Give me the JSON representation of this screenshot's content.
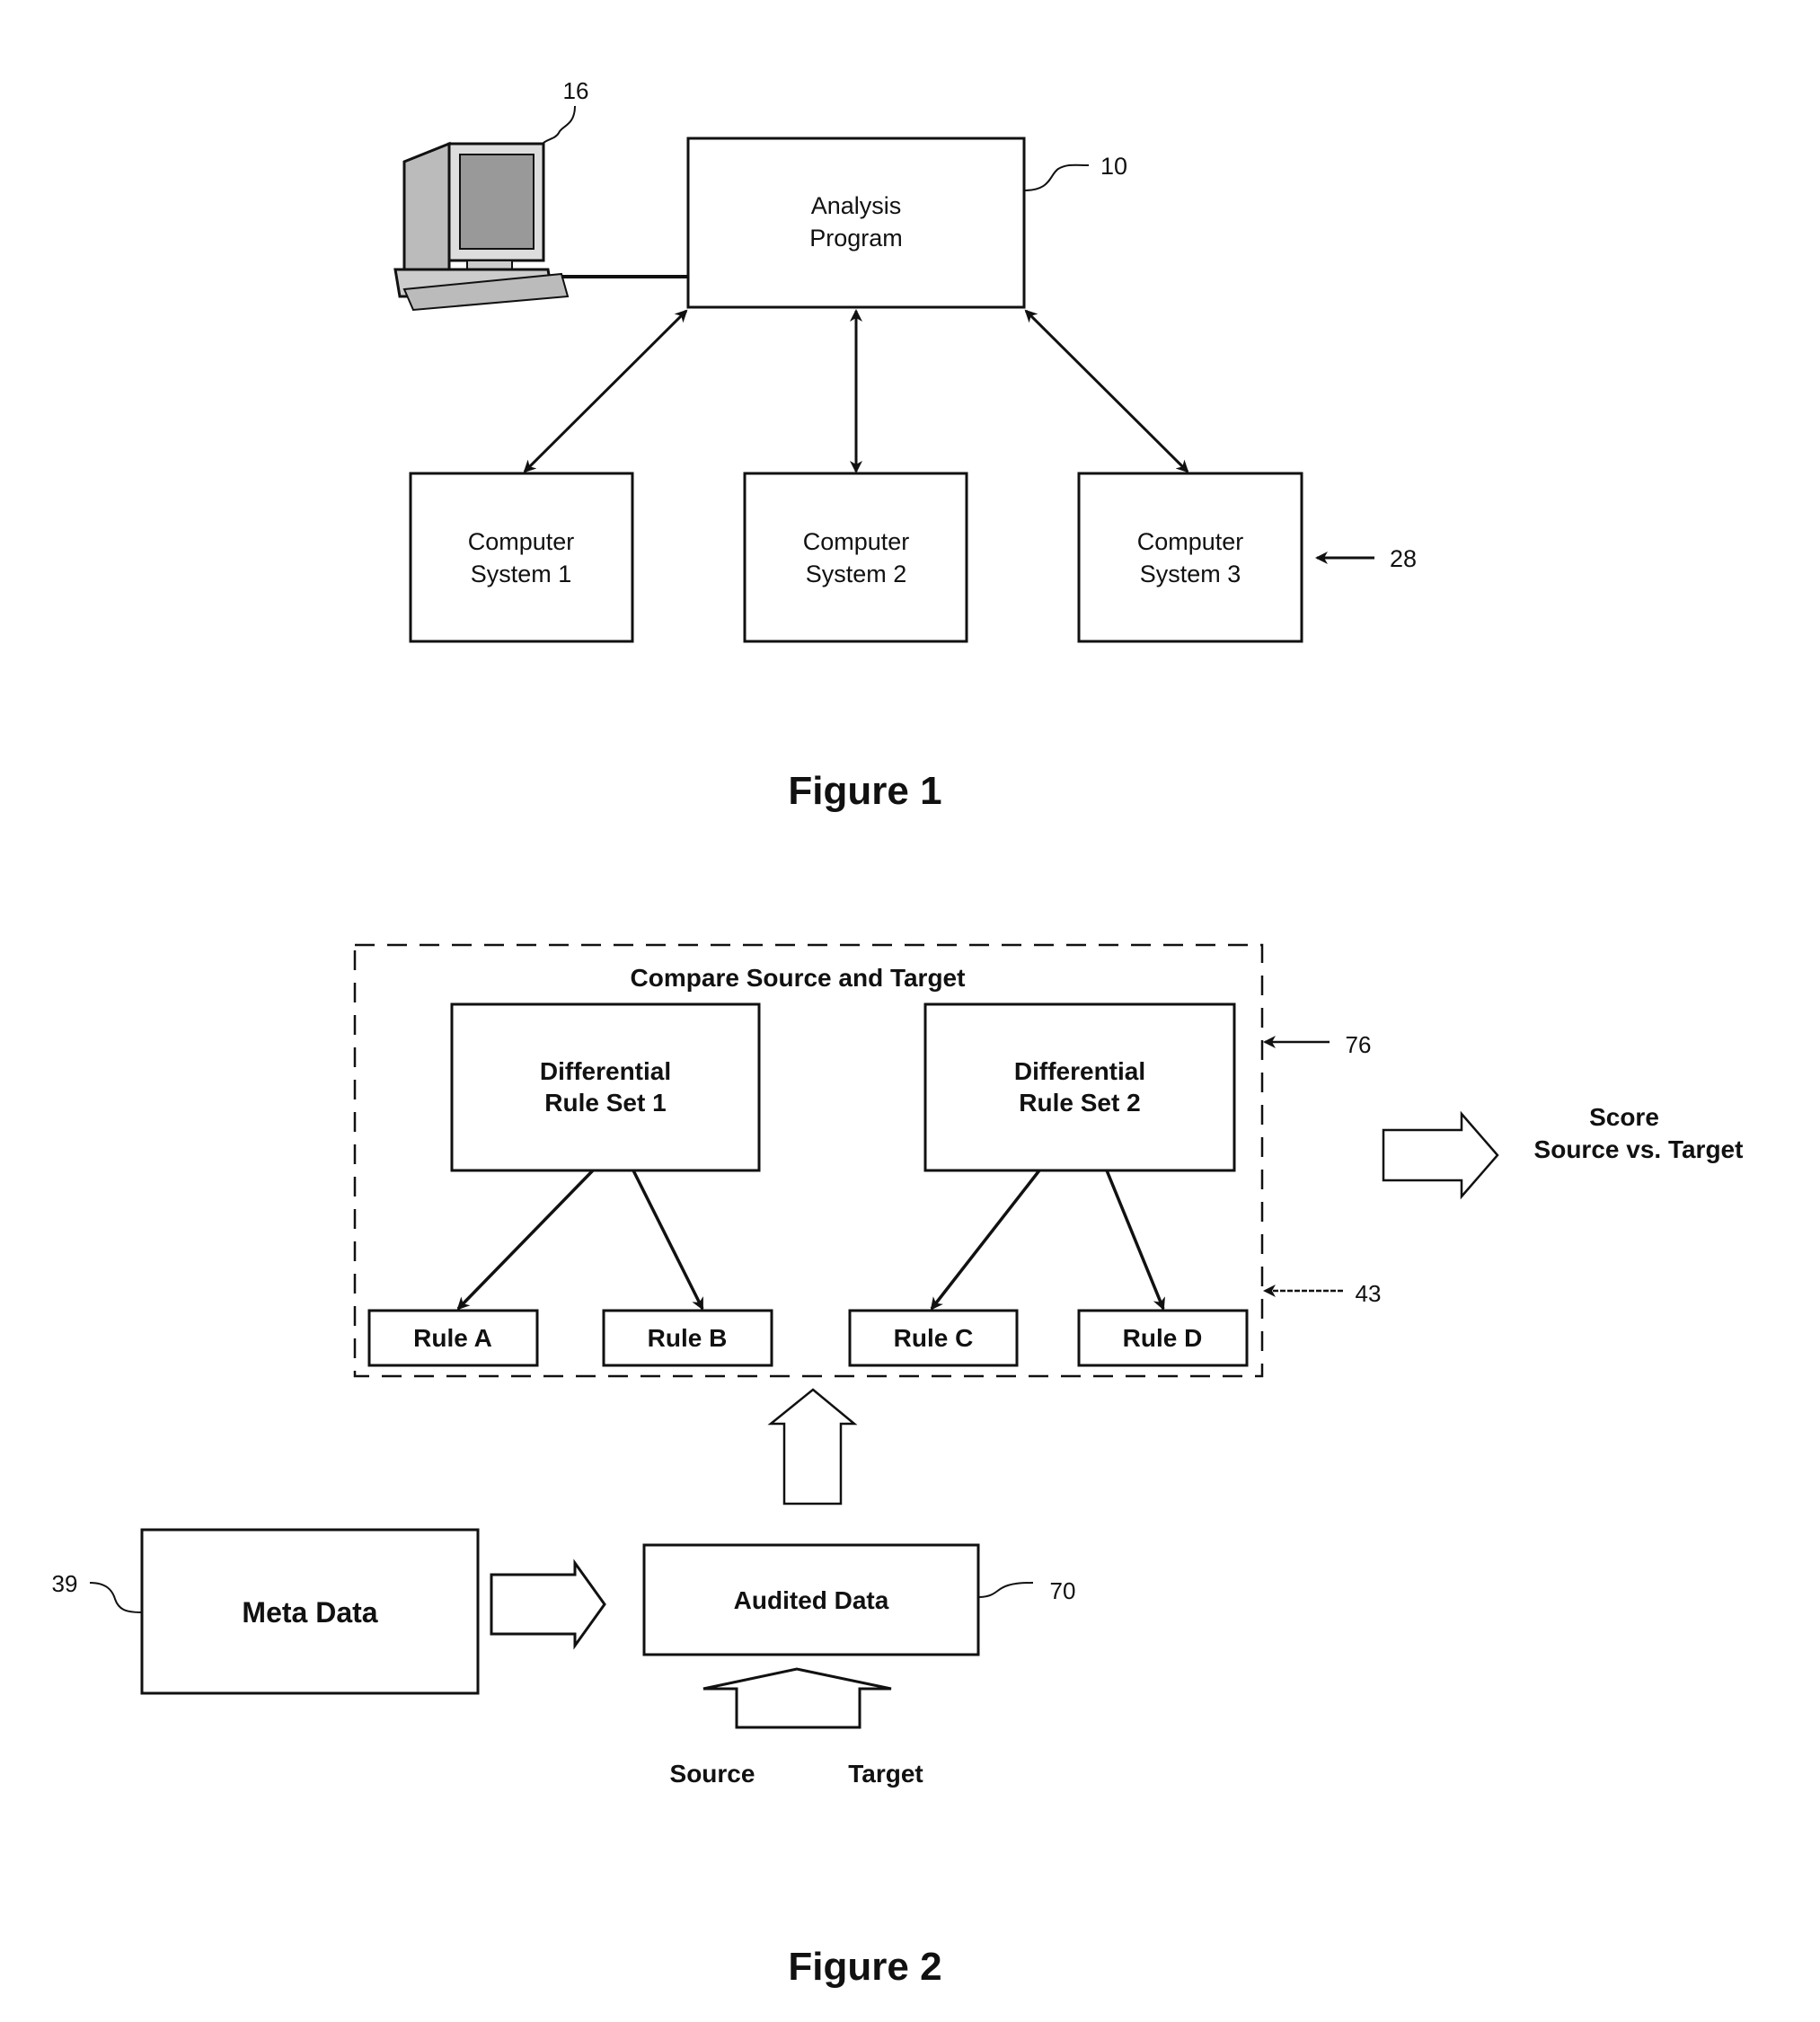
{
  "figure1": {
    "caption": "Figure 1",
    "analysis_program": {
      "line1": "Analysis",
      "line2": "Program",
      "ref": "10"
    },
    "computer_ref": "16",
    "systems": [
      {
        "line1": "Computer",
        "line2": "System 1"
      },
      {
        "line1": "Computer",
        "line2": "System 2"
      },
      {
        "line1": "Computer",
        "line2": "System 3"
      }
    ],
    "systems_ref": "28"
  },
  "figure2": {
    "caption": "Figure 2",
    "compare_title": "Compare Source and Target",
    "compare_ref": "76",
    "rules_ref": "43",
    "rule_sets": [
      {
        "line1": "Differential",
        "line2": "Rule Set 1"
      },
      {
        "line1": "Differential",
        "line2": "Rule Set 2"
      }
    ],
    "rules": [
      "Rule A",
      "Rule B",
      "Rule C",
      "Rule D"
    ],
    "score": {
      "line1": "Score",
      "line2": "Source vs. Target"
    },
    "meta_data": {
      "label": "Meta Data",
      "ref": "39"
    },
    "audited_data": {
      "label": "Audited Data",
      "ref": "70"
    },
    "inputs": {
      "source": "Source",
      "target": "Target"
    }
  }
}
